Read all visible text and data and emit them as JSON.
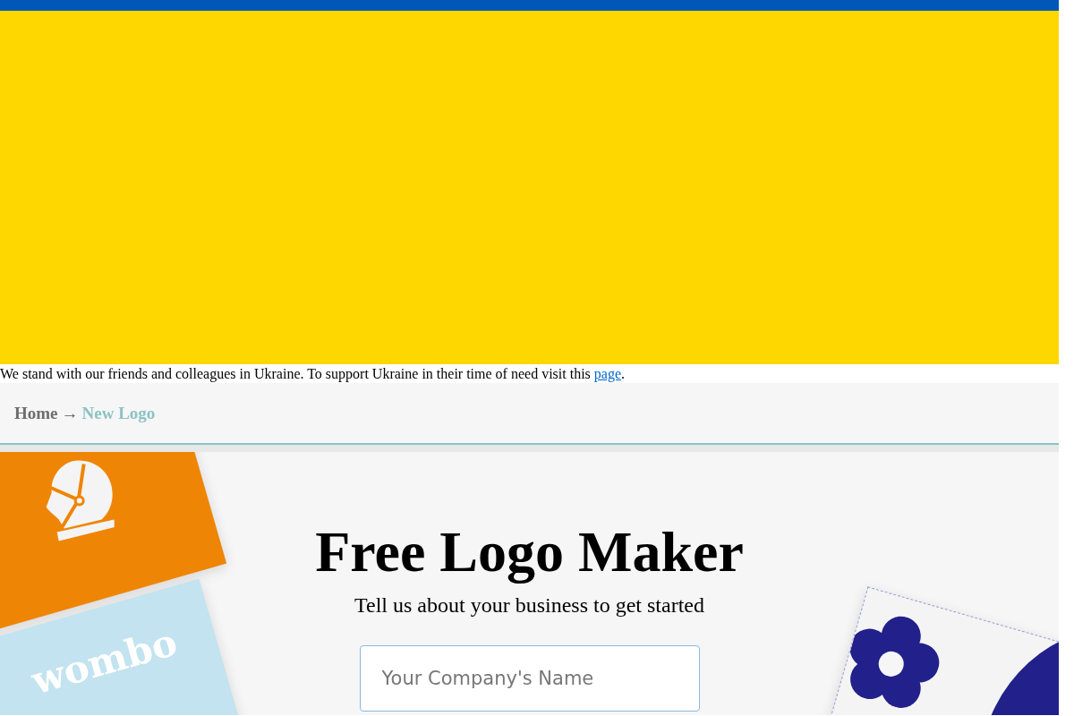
{
  "notice": {
    "text": "We stand with our friends and colleagues in Ukraine. To support Ukraine in their time of need visit this ",
    "link": "page",
    "tail": "."
  },
  "breadcrumb": {
    "separator": "→",
    "items": [
      {
        "label": "Home",
        "selected": false
      },
      {
        "label": "New Logo",
        "selected": true
      }
    ]
  },
  "hero": {
    "title": "Free Logo Maker",
    "subtitle": "Tell us about your business to get started",
    "company_field": {
      "placeholder": "Your Company's Name"
    },
    "sample_logos": [
      {
        "kind": "icon"
      },
      {
        "kind": "text",
        "text": "wombo"
      },
      {
        "kind": "flower"
      }
    ]
  }
}
